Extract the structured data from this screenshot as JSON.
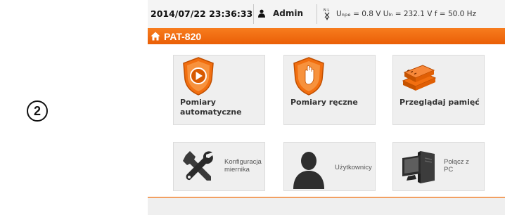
{
  "step_marker": "2",
  "status_bar": {
    "datetime": "2014/07/22 23:36:33",
    "user": "Admin",
    "voltages": "Uₙₚₑ = 0.8 V Uₗₙ = 232.1 V f = 50.0 Hz",
    "voltage_icon": "plug-n-l-icon"
  },
  "app": {
    "title": "PAT-820",
    "home_icon": "home-icon",
    "accent_color": "#f26f10"
  },
  "tiles_main": [
    {
      "label": "Pomiary automatyczne",
      "icon": "play-shield-icon"
    },
    {
      "label": "Pomiary ręczne",
      "icon": "hand-shield-icon"
    },
    {
      "label": "Przeglądaj pamięć",
      "icon": "memory-stack-icon"
    }
  ],
  "tiles_secondary": [
    {
      "label_line1": "Konfiguracja",
      "label_line2": "miernika",
      "icon": "tools-icon"
    },
    {
      "label_line1": "Użytkownicy",
      "label_line2": "",
      "icon": "user-silhouette-icon"
    },
    {
      "label_line1": "Połącz z",
      "label_line2": "PC",
      "icon": "computer-icon"
    }
  ]
}
